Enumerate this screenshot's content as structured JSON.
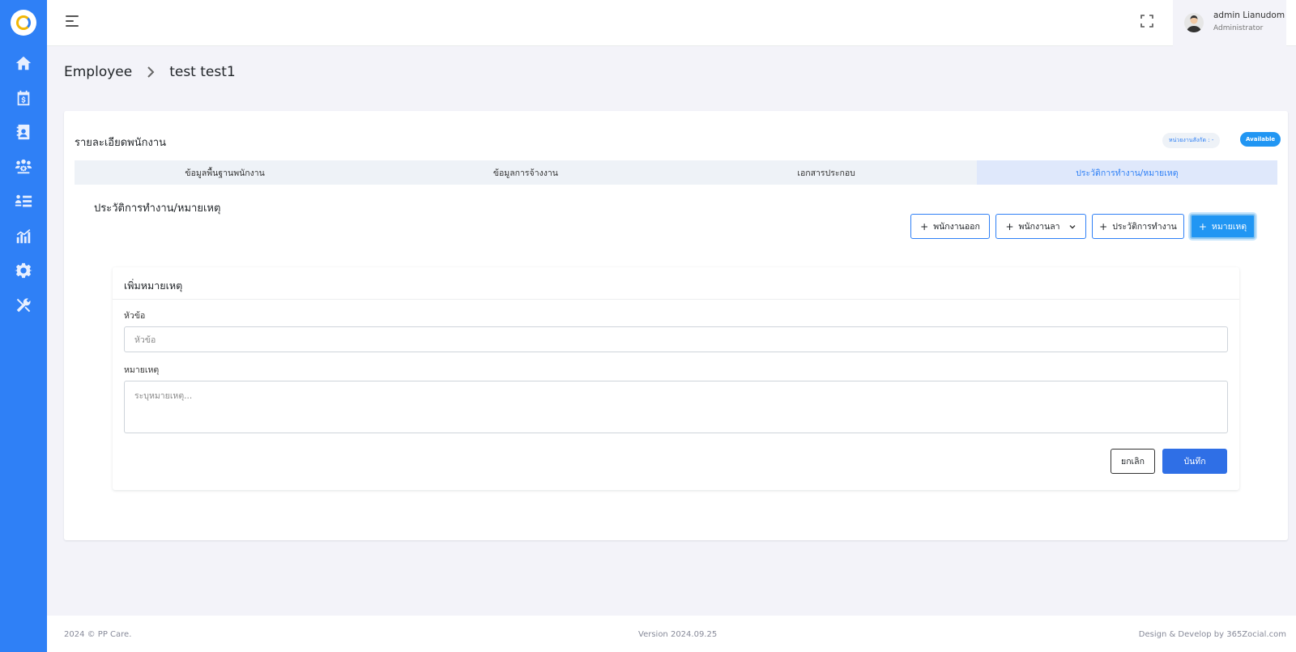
{
  "sidebar": {
    "icons": [
      "logo",
      "home-icon",
      "calendar-dollar-icon",
      "contact-book-icon",
      "users-gear-icon",
      "user-list-icon",
      "chart-icon",
      "gear-icon",
      "tools-icon"
    ]
  },
  "user": {
    "name": "admin Lianudom",
    "role": "Administrator"
  },
  "breadcrumb": {
    "parent": "Employee",
    "current": "test test1"
  },
  "card": {
    "title": "รายละเอียดพนักงาน",
    "unit_badge": "หน่วยงานสังกัด : -",
    "status_badge": "Available"
  },
  "tabs": [
    {
      "label": "ข้อมูลพื้นฐานพนักงาน",
      "active": false
    },
    {
      "label": "ข้อมูลการจ้างงาน",
      "active": false
    },
    {
      "label": "เอกสารประกอบ",
      "active": false
    },
    {
      "label": "ประวัติการทำงาน/หมายเหตุ",
      "active": true
    }
  ],
  "section": {
    "title": "ประวัติการทำงาน/หมายเหตุ"
  },
  "actions": {
    "resign": "พนักงานออก",
    "leave": "พนักงานลา",
    "work_history": "ประวัติการทำงาน",
    "note": "หมายเหตุ",
    "plus": "+"
  },
  "form": {
    "title": "เพิ่มหมายเหตุ",
    "topic_label": "หัวข้อ",
    "topic_placeholder": "หัวข้อ",
    "note_label": "หมายเหตุ",
    "note_placeholder": "ระบุหมายเหตุ...",
    "cancel": "ยกเลิก",
    "save": "บันทึก"
  },
  "footer": {
    "copyright": "2024 © PP Care.",
    "version": "Version 2024.09.25",
    "credit": "Design & Develop by 365Zocial.com"
  },
  "colors": {
    "sidebar": "#2f80f6",
    "primary": "#2196f3",
    "save": "#2f6fe6"
  }
}
